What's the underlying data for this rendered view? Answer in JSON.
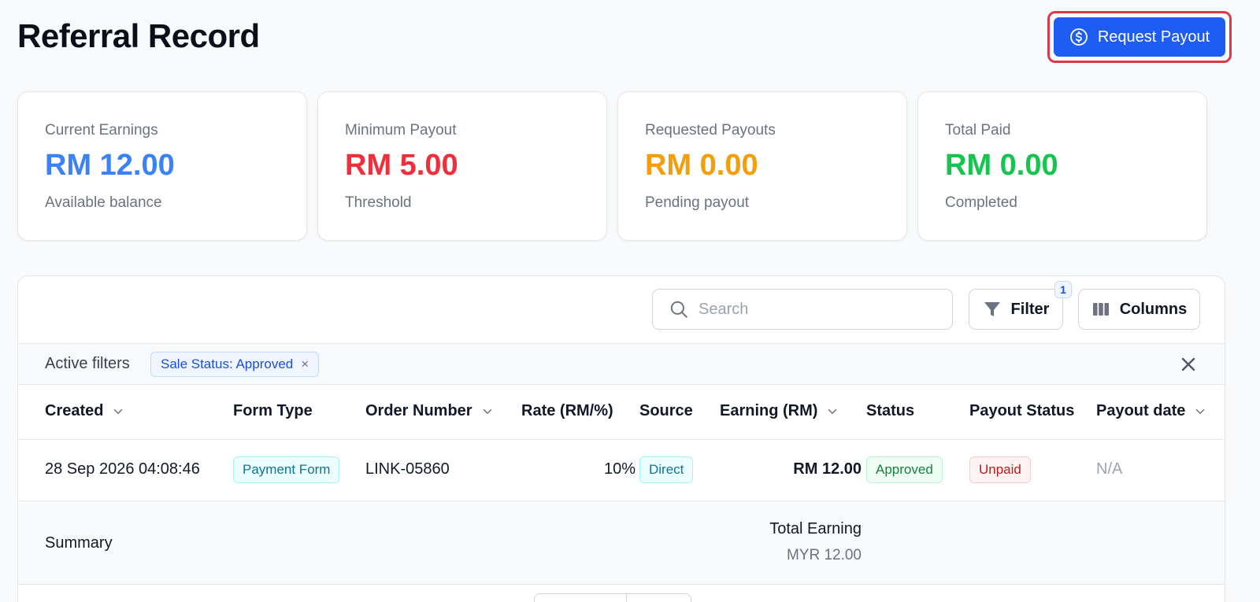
{
  "header": {
    "title": "Referral Record",
    "request_payout_label": "Request Payout",
    "request_payout_icon": "dollar-circle-icon"
  },
  "cards": [
    {
      "label": "Current Earnings",
      "value": "RM 12.00",
      "sub": "Available balance",
      "color": "#3b82f6"
    },
    {
      "label": "Minimum Payout",
      "value": "RM 5.00",
      "sub": "Threshold",
      "color": "#ef2f3c"
    },
    {
      "label": "Requested Payouts",
      "value": "RM 0.00",
      "sub": "Pending payout",
      "color": "#f59e0b"
    },
    {
      "label": "Total Paid",
      "value": "RM 0.00",
      "sub": "Completed",
      "color": "#16c44f"
    }
  ],
  "toolbar": {
    "search_placeholder": "Search",
    "search_value": "",
    "filter_label": "Filter",
    "filter_count": "1",
    "columns_label": "Columns"
  },
  "filters": {
    "label": "Active filters",
    "chips": [
      {
        "text": "Sale Status: Approved",
        "remove": "×"
      }
    ]
  },
  "table": {
    "columns": [
      {
        "label": "Created",
        "sortable": true
      },
      {
        "label": "Form Type",
        "sortable": false
      },
      {
        "label": "Order Number",
        "sortable": true
      },
      {
        "label": "Rate (RM/%)",
        "sortable": false
      },
      {
        "label": "Source",
        "sortable": false
      },
      {
        "label": "Earning (RM)",
        "sortable": true
      },
      {
        "label": "Status",
        "sortable": false
      },
      {
        "label": "Payout Status",
        "sortable": false
      },
      {
        "label": "Payout date",
        "sortable": true
      }
    ],
    "rows": [
      {
        "created": "28 Sep 2026 04:08:46",
        "form_type": "Payment Form",
        "order_number": "LINK-05860",
        "rate": "10%",
        "source": "Direct",
        "earning": "RM 12.00",
        "status": "Approved",
        "payout_status": "Unpaid",
        "payout_date": "N/A"
      }
    ]
  },
  "summary": {
    "label": "Summary",
    "total_label": "Total Earning",
    "total_value": "MYR 12.00"
  }
}
